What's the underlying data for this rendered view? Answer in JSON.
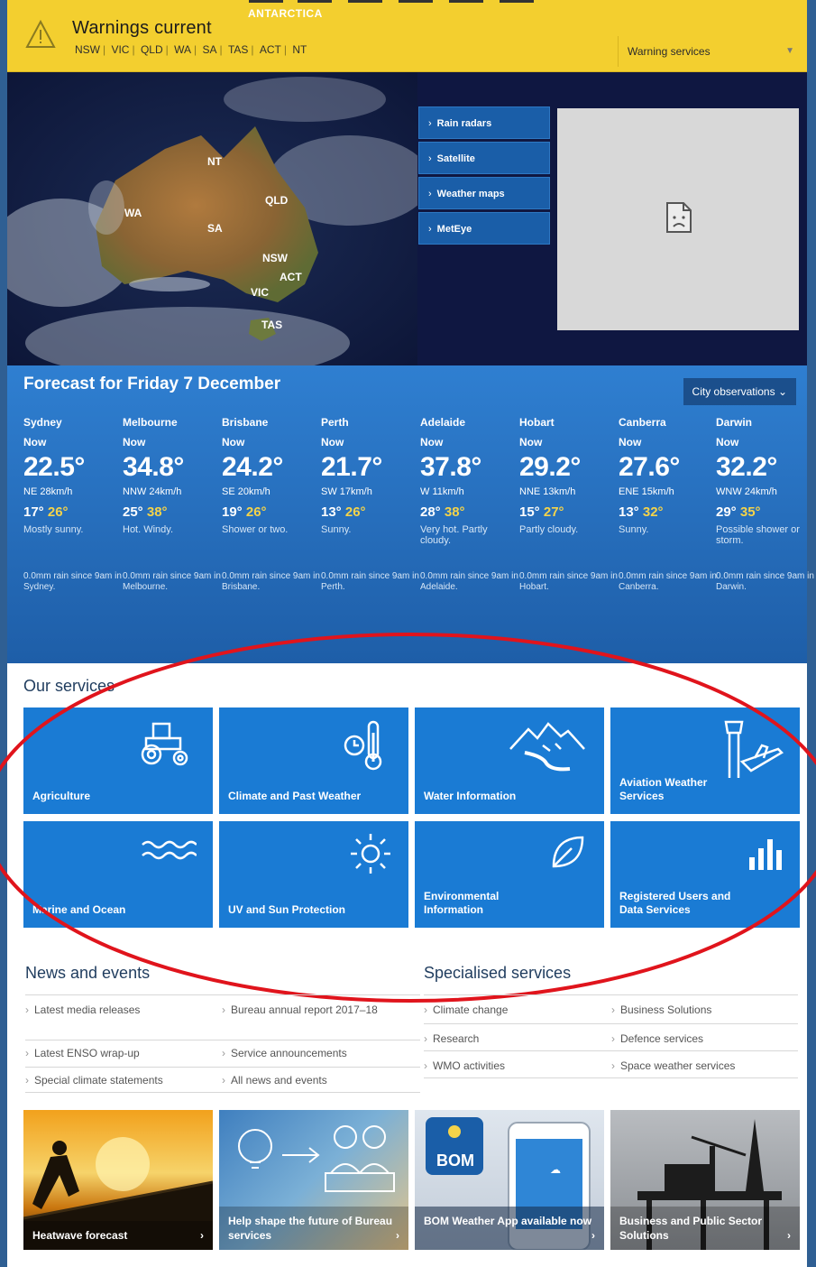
{
  "warnings": {
    "title": "Warnings current",
    "states": [
      "NSW",
      "VIC",
      "QLD",
      "WA",
      "SA",
      "TAS",
      "ACT",
      "NT"
    ],
    "services_label": "Warning services",
    "top_label": "ANTARCTICA"
  },
  "map": {
    "labels": {
      "nt": "NT",
      "qld": "QLD",
      "wa": "WA",
      "sa": "SA",
      "nsw": "NSW",
      "act": "ACT",
      "vic": "VIC",
      "tas": "TAS"
    }
  },
  "hero_links": [
    "Rain radars",
    "Satellite",
    "Weather maps",
    "MetEye"
  ],
  "forecast": {
    "title": "Forecast for Friday 7 December",
    "city_obs_label": "City observations",
    "now_label": "Now",
    "cities": [
      {
        "name": "Sydney",
        "temp": "22.5°",
        "wind": "NE 28km/h",
        "min": "17°",
        "max": "26°",
        "desc": "Mostly sunny.",
        "rain": "0.0mm rain since 9am in Sydney."
      },
      {
        "name": "Melbourne",
        "temp": "34.8°",
        "wind": "NNW 24km/h",
        "min": "25°",
        "max": "38°",
        "desc": "Hot. Windy.",
        "rain": "0.0mm rain since 9am in Melbourne."
      },
      {
        "name": "Brisbane",
        "temp": "24.2°",
        "wind": "SE 20km/h",
        "min": "19°",
        "max": "26°",
        "desc": "Shower or two.",
        "rain": "0.0mm rain since 9am in Brisbane."
      },
      {
        "name": "Perth",
        "temp": "21.7°",
        "wind": "SW 17km/h",
        "min": "13°",
        "max": "26°",
        "desc": "Sunny.",
        "rain": "0.0mm rain since 9am in Perth."
      },
      {
        "name": "Adelaide",
        "temp": "37.8°",
        "wind": "W 11km/h",
        "min": "28°",
        "max": "38°",
        "desc": "Very hot. Partly cloudy.",
        "rain": "0.0mm rain since 9am in Adelaide."
      },
      {
        "name": "Hobart",
        "temp": "29.2°",
        "wind": "NNE 13km/h",
        "min": "15°",
        "max": "27°",
        "desc": "Partly cloudy.",
        "rain": "0.0mm rain since 9am in Hobart."
      },
      {
        "name": "Canberra",
        "temp": "27.6°",
        "wind": "ENE 15km/h",
        "min": "13°",
        "max": "32°",
        "desc": "Sunny.",
        "rain": "0.0mm rain since 9am in Canberra."
      },
      {
        "name": "Darwin",
        "temp": "32.2°",
        "wind": "WNW 24km/h",
        "min": "29°",
        "max": "35°",
        "desc": "Possible shower or storm.",
        "rain": "0.0mm rain since 9am in Darwin."
      }
    ]
  },
  "services": {
    "title": "Our services",
    "items": [
      {
        "label": "Agriculture",
        "icon": "tractor-icon"
      },
      {
        "label": "Climate and Past Weather",
        "icon": "clock-thermometer-icon"
      },
      {
        "label": "Water Information",
        "icon": "mountains-river-icon"
      },
      {
        "label": "Aviation Weather Services",
        "icon": "control-tower-plane-icon"
      },
      {
        "label": "Marine and Ocean",
        "icon": "waves-icon"
      },
      {
        "label": "UV and Sun Protection",
        "icon": "sun-icon"
      },
      {
        "label": "Environmental Information",
        "icon": "leaf-icon"
      },
      {
        "label": "Registered Users and Data Services",
        "icon": "bar-chart-icon"
      }
    ]
  },
  "news": {
    "title": "News and events",
    "col1": [
      "Latest media releases",
      "Latest ENSO wrap-up",
      "Special climate statements"
    ],
    "col2": [
      "Bureau annual report 2017–18",
      "Service announcements",
      "All news and events"
    ]
  },
  "specialised": {
    "title": "Specialised services",
    "col1": [
      "Climate change",
      "Research",
      "WMO activities"
    ],
    "col2": [
      "Business Solutions",
      "Defence services",
      "Space weather services"
    ]
  },
  "promos": [
    {
      "label": "Heatwave forecast"
    },
    {
      "label": "Help shape the future of Bureau services"
    },
    {
      "label": "BOM Weather App available now",
      "badge": "BOM"
    },
    {
      "label": "Business and Public Sector Solutions"
    }
  ],
  "colors": {
    "warning_yellow": "#f3cf2f",
    "brand_blue": "#1a7bd4",
    "annotation_red": "#e0141c"
  }
}
